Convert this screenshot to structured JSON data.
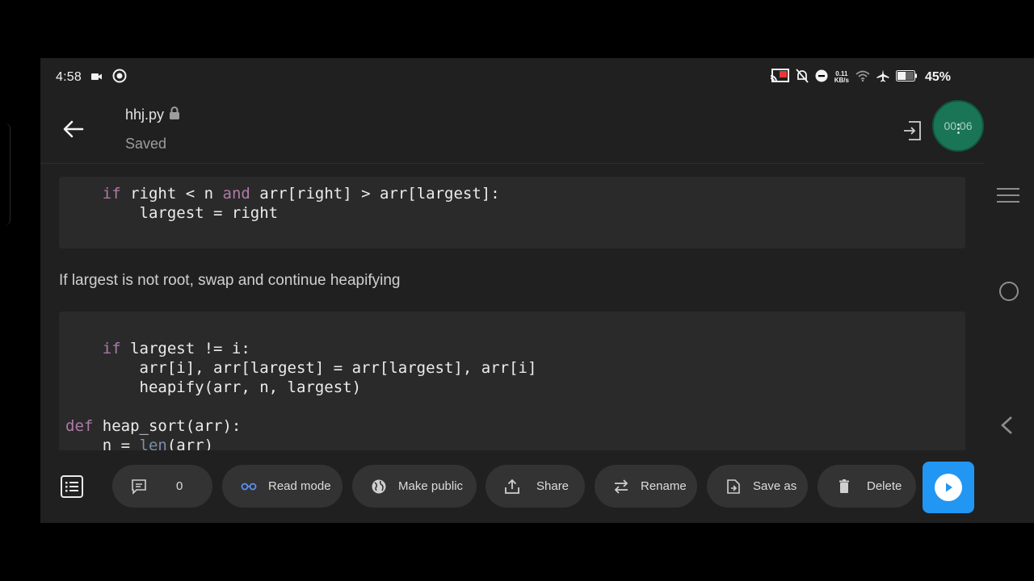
{
  "status_bar": {
    "time": "4:58",
    "net_speed_value": "0.11",
    "net_speed_unit": "KB/s",
    "battery": "45%"
  },
  "header": {
    "filename": "hhj.py",
    "save_status": "Saved",
    "timer": "00:06"
  },
  "code_block_1": {
    "line1": {
      "indent": "    ",
      "kw1": "if",
      "a": " right < n ",
      "kw2": "and",
      "b": " arr[right] > arr[largest]:"
    },
    "line2": "        largest = right"
  },
  "prose": "If largest is not root, swap and continue heapifying",
  "code_block_2": {
    "line1": {
      "indent": "    ",
      "kw": "if",
      "rest": " largest != i:"
    },
    "line2": "        arr[i], arr[largest] = arr[largest], arr[i]",
    "line3": "        heapify(arr, n, largest)",
    "line4": {
      "kw": "def",
      "rest": " heap_sort(arr):"
    },
    "line5": {
      "indent": "    ",
      "a": "n = ",
      "builtin": "len",
      "b": "(arr)"
    }
  },
  "toolbar": {
    "comment_count": "0",
    "read_mode": "Read mode",
    "make_public": "Make public",
    "share": "Share",
    "rename": "Rename",
    "save_as": "Save as",
    "delete": "Delete"
  },
  "colors": {
    "keyword": "#b07aa8",
    "builtin": "#7b8ea8",
    "run_button": "#2196f3",
    "timer_bg": "#1a7a5a"
  }
}
